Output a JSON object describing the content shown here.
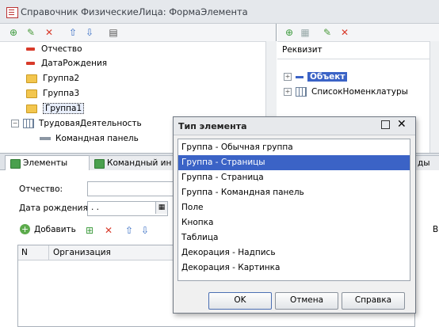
{
  "window": {
    "title": "Справочник ФизическиеЛица: ФормаЭлемента"
  },
  "left_panel": {
    "tree": [
      {
        "label": "Отчество",
        "icon": "red-dash-icon"
      },
      {
        "label": "ДатаРождения",
        "icon": "red-dash-icon"
      },
      {
        "label": "Группа2",
        "icon": "folder-icon"
      },
      {
        "label": "Группа3",
        "icon": "folder-icon"
      },
      {
        "label": "Группа1",
        "icon": "folder-icon"
      },
      {
        "label": "ТрудоваяДеятельность",
        "icon": "table-icon"
      },
      {
        "label": "Командная панель",
        "icon": "command-panel-icon"
      }
    ]
  },
  "right_panel": {
    "column_header": "Реквизит",
    "tree": [
      {
        "label": "Объект"
      },
      {
        "label": "СписокНоменклатуры"
      }
    ]
  },
  "tabs": [
    {
      "label": "Элементы"
    },
    {
      "label": "Командный ин"
    },
    {
      "label": "ды"
    }
  ],
  "form": {
    "patronymic_label": "Отчество:",
    "birthdate_label": "Дата рождения:",
    "birthdate_value": " .  .",
    "add_button": "Добавить",
    "grid_columns": [
      "N",
      "Организация"
    ],
    "right_edge_letter": "В"
  },
  "dialog": {
    "title": "Тип элемента",
    "items": [
      "Группа - Обычная группа",
      "Группа - Страницы",
      "Группа - Страница",
      "Группа - Командная панель",
      "Поле",
      "Кнопка",
      "Таблица",
      "Декорация - Надпись",
      "Декорация - Картинка"
    ],
    "selected_index": 1,
    "buttons": {
      "ok": "OK",
      "cancel": "Отмена",
      "help": "Справка"
    }
  },
  "colors": {
    "selection": "#3b63c6",
    "accent_green": "#4aa04e",
    "delete_red": "#d83a2a"
  }
}
